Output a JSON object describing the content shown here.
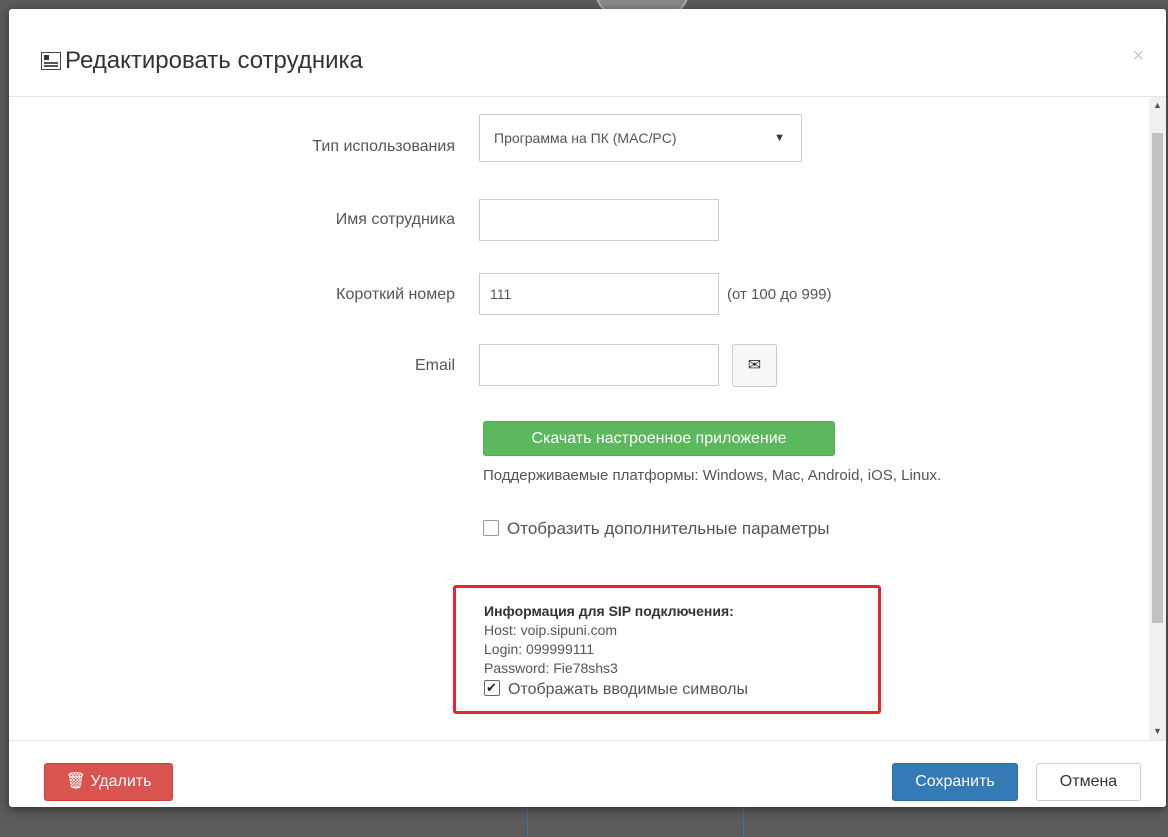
{
  "dialog": {
    "title": "Редактировать сотрудника",
    "close_glyph": "×"
  },
  "form": {
    "usage_type": {
      "label": "Тип использования",
      "selected": "Программа на ПК (MAC/PC)"
    },
    "employee_name": {
      "label": "Имя сотрудника",
      "value": ""
    },
    "short_number": {
      "label": "Короткий номер",
      "value": "111",
      "hint": "(от 100 до 999)"
    },
    "email": {
      "label": "Email",
      "value": "",
      "button_icon": "envelope-icon"
    },
    "download_button": "Скачать настроенное приложение",
    "platforms_text": "Поддерживаемые платформы: Windows, Mac, Android, iOS, Linux.",
    "advanced_params": {
      "label": "Отобразить дополнительные параметры",
      "checked": false
    }
  },
  "sip": {
    "title": "Информация для SIP подключения:",
    "host": "Host: voip.sipuni.com",
    "login": "Login: 099999111",
    "password": "Password: Fie78shs3",
    "show_chars": {
      "label": "Отображать вводимые символы",
      "checked": true
    },
    "highlight_color": "#e8242c"
  },
  "footer": {
    "delete_label": "Удалить",
    "delete_icon": "trash-icon",
    "save_label": "Сохранить",
    "cancel_label": "Отмена"
  },
  "colors": {
    "delete": "#d9534f",
    "save": "#337ab7",
    "download": "#5cb85c"
  }
}
